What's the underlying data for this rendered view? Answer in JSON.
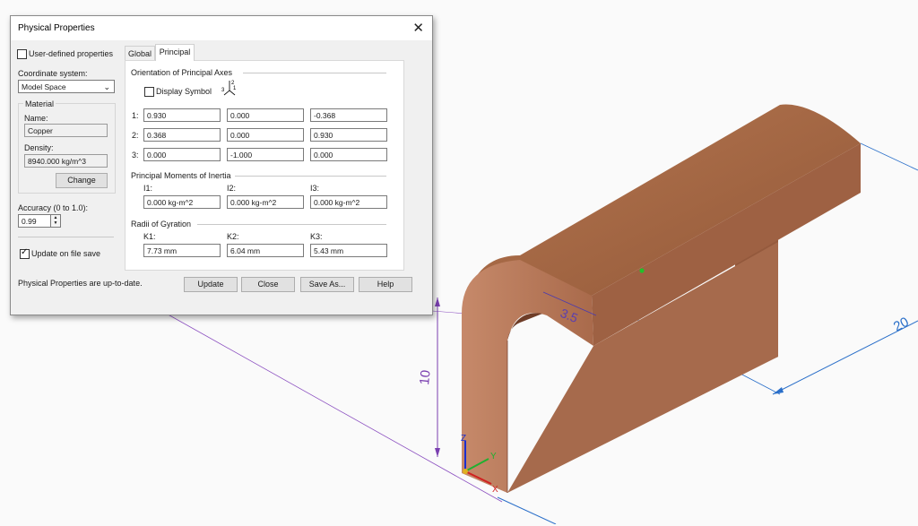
{
  "dialog": {
    "title": "Physical Properties",
    "user_defined_label": "User-defined properties",
    "user_defined_checked": false,
    "coord_system_label": "Coordinate system:",
    "coord_system_value": "Model Space",
    "material_group": "Material",
    "name_label": "Name:",
    "name_value": "Copper",
    "density_label": "Density:",
    "density_value": "8940.000 kg/m^3",
    "change_button": "Change",
    "accuracy_label": "Accuracy (0 to 1.0):",
    "accuracy_value": "0.99",
    "update_on_save_label": "Update on file save",
    "update_on_save_checked": true,
    "status_text": "Physical Properties are up-to-date.",
    "tabs": [
      "Global",
      "Principal"
    ],
    "active_tab": "Principal",
    "orientation_title": "Orientation of Principal Axes",
    "display_symbol_label": "Display Symbol",
    "display_symbol_checked": false,
    "axis_symbol_labels": [
      "2",
      "3",
      "1"
    ],
    "axes_rows": [
      {
        "label": "1:",
        "values": [
          "0.930",
          "0.000",
          "-0.368"
        ]
      },
      {
        "label": "2:",
        "values": [
          "0.368",
          "0.000",
          "0.930"
        ]
      },
      {
        "label": "3:",
        "values": [
          "0.000",
          "-1.000",
          "0.000"
        ]
      }
    ],
    "moments_title": "Principal Moments of Inertia",
    "moments": [
      {
        "label": "I1:",
        "value": "0.000 kg-m^2"
      },
      {
        "label": "I2:",
        "value": "0.000 kg-m^2"
      },
      {
        "label": "I3:",
        "value": "0.000 kg-m^2"
      }
    ],
    "gyration_title": "Radii of Gyration",
    "gyration": [
      {
        "label": "K1:",
        "value": "7.73 mm"
      },
      {
        "label": "K2:",
        "value": "6.04 mm"
      },
      {
        "label": "K3:",
        "value": "5.43 mm"
      }
    ],
    "buttons": [
      "Update",
      "Close",
      "Save As...",
      "Help"
    ]
  },
  "model": {
    "dimensions": [
      "3.5",
      "10",
      "20"
    ],
    "triad_labels": [
      "Z",
      "Y",
      "X"
    ],
    "colors": {
      "copper_top": "#a7694a",
      "copper_front": "#b57a5c",
      "copper_side": "#8f553a",
      "dimension_blue": "#2a6fc9",
      "dimension_purple": "#7a3fb0",
      "cg_dot": "#22c02a"
    }
  }
}
